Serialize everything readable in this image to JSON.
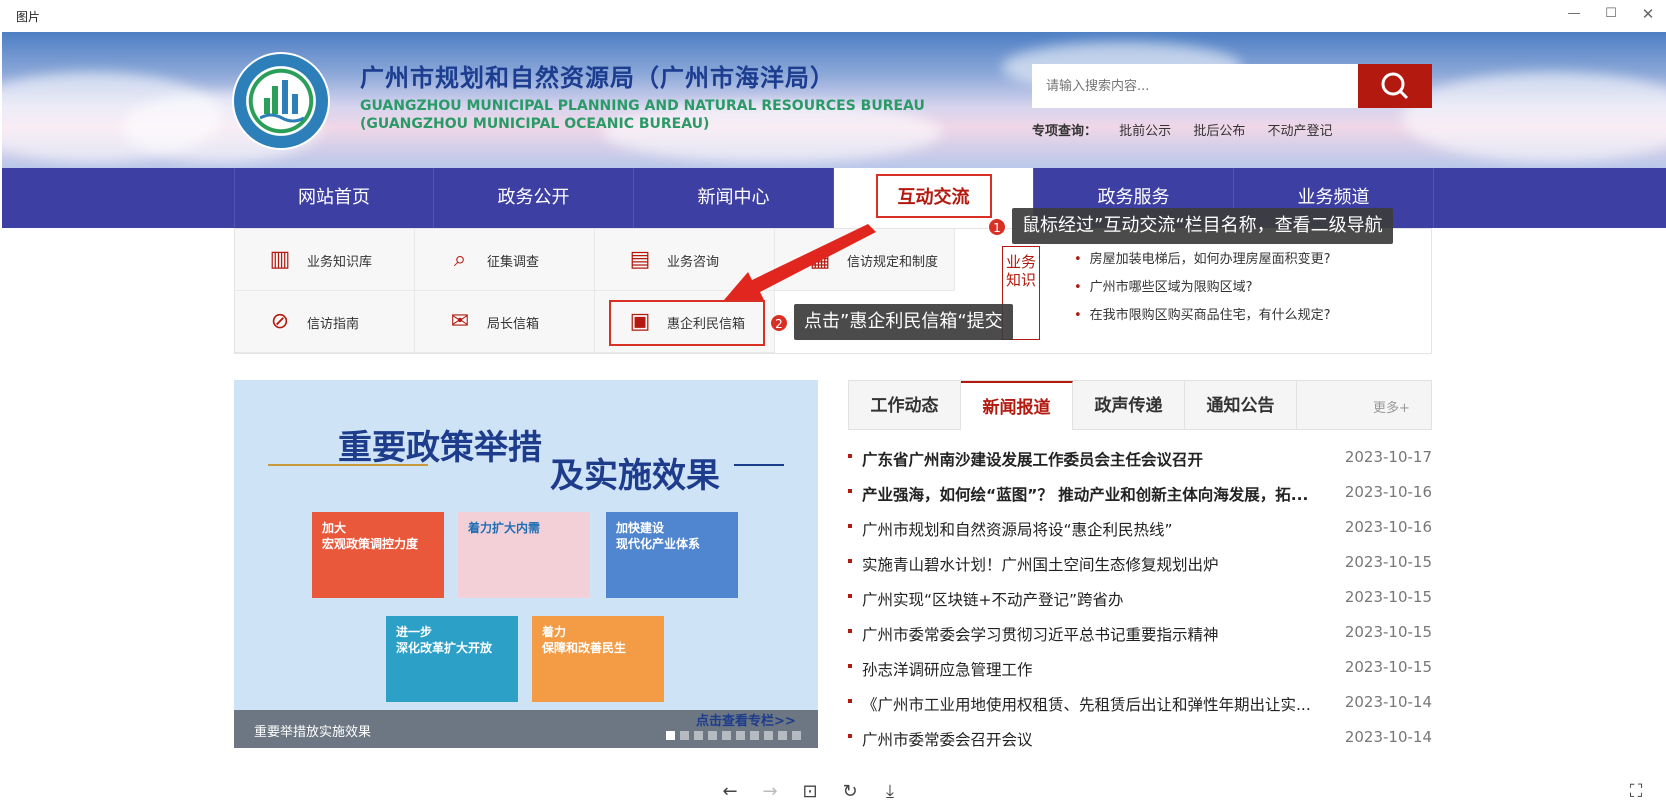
{
  "window": {
    "title": "图片"
  },
  "header": {
    "title_cn": "广州市规划和自然资源局（广州市海洋局）",
    "title_en_1": "GUANGZHOU MUNICIPAL PLANNING AND NATURAL RESOURCES BUREAU",
    "title_en_2": "(GUANGZHOU MUNICIPAL OCEANIC BUREAU)",
    "search_placeholder": "请输入搜索内容...",
    "quick_label": "专项查询：",
    "quick_links": [
      "批前公示",
      "批后公布",
      "不动产登记"
    ]
  },
  "nav": {
    "items": [
      "网站首页",
      "政务公开",
      "新闻中心",
      "互动交流",
      "政务服务",
      "业务频道"
    ],
    "active": "互动交流"
  },
  "submenu": {
    "items": [
      {
        "label": "业务知识库",
        "icon": "book-icon"
      },
      {
        "label": "征集调查",
        "icon": "survey-icon"
      },
      {
        "label": "业务咨询",
        "icon": "chat-icon"
      },
      {
        "label": "信访规定和制度",
        "icon": "rules-icon"
      },
      {
        "label": "信访指南",
        "icon": "compass-icon"
      },
      {
        "label": "局长信箱",
        "icon": "mail-icon"
      },
      {
        "label": "惠企利民信箱",
        "icon": "inbox-icon"
      }
    ],
    "kb_tag": "业务知识",
    "kb_items": [
      "房屋加装电梯后，如何办理房屋面积变更?",
      "广州市哪些区域为限购区域?",
      "在我市限购区购买商品住宅，有什么规定?"
    ]
  },
  "tips": [
    {
      "num": "1",
      "text": "鼠标经过”互动交流“栏目名称，查看二级导航"
    },
    {
      "num": "2",
      "text": "点击”惠企利民信箱“提交"
    }
  ],
  "promo": {
    "title_1": "重要政策举措",
    "title_2": "及实施效果",
    "tiles": [
      "加大\n宏观政策调控力度",
      "着力扩大内需",
      "加快建设\n现代化产业体系",
      "进一步\n深化改革扩大开放",
      "着力\n保障和改善民生"
    ],
    "caption": "重要举措放实施效果",
    "more": "点击查看专栏>>",
    "slide_count": 10,
    "active_slide": 0
  },
  "news": {
    "tabs": [
      "工作动态",
      "新闻报道",
      "政声传递",
      "通知公告"
    ],
    "active_tab": "新闻报道",
    "more": "更多+",
    "items": [
      {
        "title": "广东省广州南沙建设发展工作委员会主任会议召开",
        "date": "2023-10-17",
        "bold": true
      },
      {
        "title": "产业强海，如何绘“蓝图”？ 推动产业和创新主体向海发展，拓...",
        "date": "2023-10-16",
        "bold": true
      },
      {
        "title": "广州市规划和自然资源局将设“惠企利民热线”",
        "date": "2023-10-16",
        "bold": false
      },
      {
        "title": "实施青山碧水计划！广州国土空间生态修复规划出炉",
        "date": "2023-10-15",
        "bold": false
      },
      {
        "title": "广州实现“区块链+不动产登记”跨省办",
        "date": "2023-10-15",
        "bold": false
      },
      {
        "title": "广州市委常委会学习贯彻习近平总书记重要指示精神",
        "date": "2023-10-15",
        "bold": false
      },
      {
        "title": "孙志洋调研应急管理工作",
        "date": "2023-10-15",
        "bold": false
      },
      {
        "title": "《广州市工业用地使用权租赁、先租赁后出让和弹性年期出让实...",
        "date": "2023-10-14",
        "bold": false
      },
      {
        "title": "广州市委常委会召开会议",
        "date": "2023-10-14",
        "bold": false
      }
    ]
  },
  "colors": {
    "nav_bg": "#3e3fa3",
    "accent_red": "#b3190e",
    "title_blue": "#1c3d8f",
    "title_green": "#2a9a67"
  }
}
